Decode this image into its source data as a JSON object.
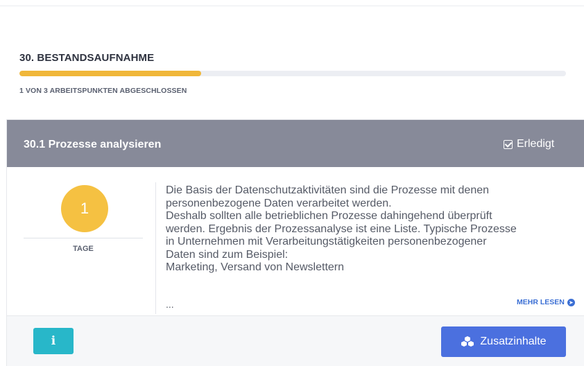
{
  "section": {
    "title": "30. BESTANDSAUFNAHME",
    "progress_fraction": 0.333,
    "progress_caption": "1 VON 3 ARBEITSPUNKTEN ABGESCHLOSSEN"
  },
  "task": {
    "title": "30.1 Prozesse analysieren",
    "done_label": "Erledigt",
    "done_checked": true,
    "days_value": "1",
    "days_label": "TAGE",
    "description": "Die Basis der Datenschutzaktivitäten sind die Prozesse mit denen\npersonenbezogene Daten verarbeitet werden.\nDeshalb sollten alle betrieblichen Prozesse dahingehend überprüft\nwerden. Ergebnis der Prozessanalyse ist eine Liste. Typische Prozesse\nin Unternehmen mit Verarbeitungstätigkeiten personenbezogener\nDaten sind zum Beispiel:\nMarketing, Versand von Newslettern",
    "ellipsis": "...",
    "read_more_label": "MEHR LESEN",
    "info_button_label": "i",
    "extra_button_label": "Zusatzinhalte"
  },
  "colors": {
    "progress_fill": "#f0b73a",
    "header_bg": "#878a99",
    "days_circle": "#f5c142",
    "info_button": "#28b7c9",
    "extra_button": "#4b70df",
    "link": "#3b6fd4"
  },
  "icons": {
    "done": "checkbox-checked-icon",
    "read_more": "arrow-circle-right-icon",
    "extra": "cubes-icon"
  }
}
